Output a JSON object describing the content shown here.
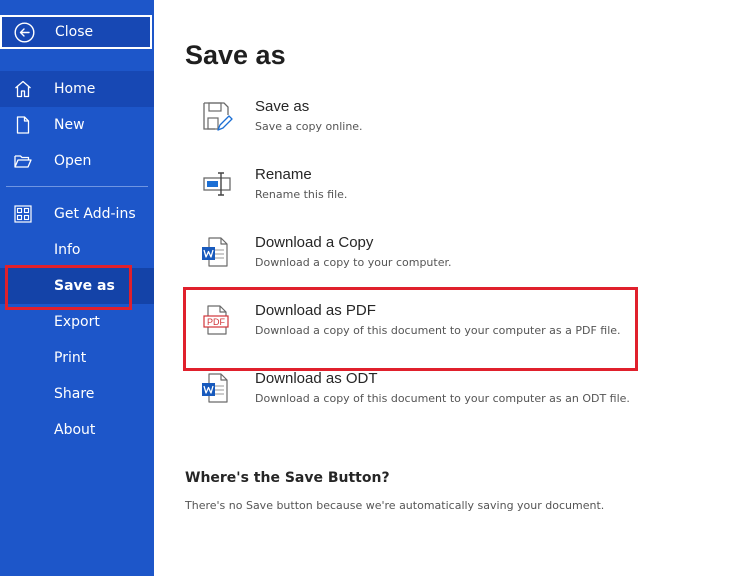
{
  "sidebar": {
    "close_label": "Close",
    "items": [
      {
        "label": "Home",
        "icon": "home-icon"
      },
      {
        "label": "New",
        "icon": "new-document-icon"
      },
      {
        "label": "Open",
        "icon": "open-folder-icon"
      },
      {
        "label": "Get Add-ins",
        "icon": "add-ins-grid-icon"
      },
      {
        "label": "Info"
      },
      {
        "label": "Save as"
      },
      {
        "label": "Export"
      },
      {
        "label": "Print"
      },
      {
        "label": "Share"
      },
      {
        "label": "About"
      }
    ]
  },
  "main": {
    "title": "Save as",
    "options": [
      {
        "title": "Save as",
        "desc": "Save a copy online.",
        "icon": "save-as-icon"
      },
      {
        "title": "Rename",
        "desc": "Rename this file.",
        "icon": "rename-icon"
      },
      {
        "title": "Download a Copy",
        "desc": "Download a copy to your computer.",
        "icon": "word-document-icon"
      },
      {
        "title": "Download as PDF",
        "desc": "Download a copy of this document to your computer as a PDF file.",
        "icon": "pdf-icon",
        "icon_text": "PDF"
      },
      {
        "title": "Download as ODT",
        "desc": "Download a copy of this document to your computer as an ODT file.",
        "icon": "word-document-icon"
      }
    ],
    "help_title": "Where's the Save Button?",
    "help_desc": "There's no Save button because we're automatically saving your document."
  },
  "colors": {
    "sidebar_bg": "#1d56c9",
    "highlight": "#e0202c",
    "word_blue": "#185abd",
    "pdf_red": "#d13438"
  }
}
